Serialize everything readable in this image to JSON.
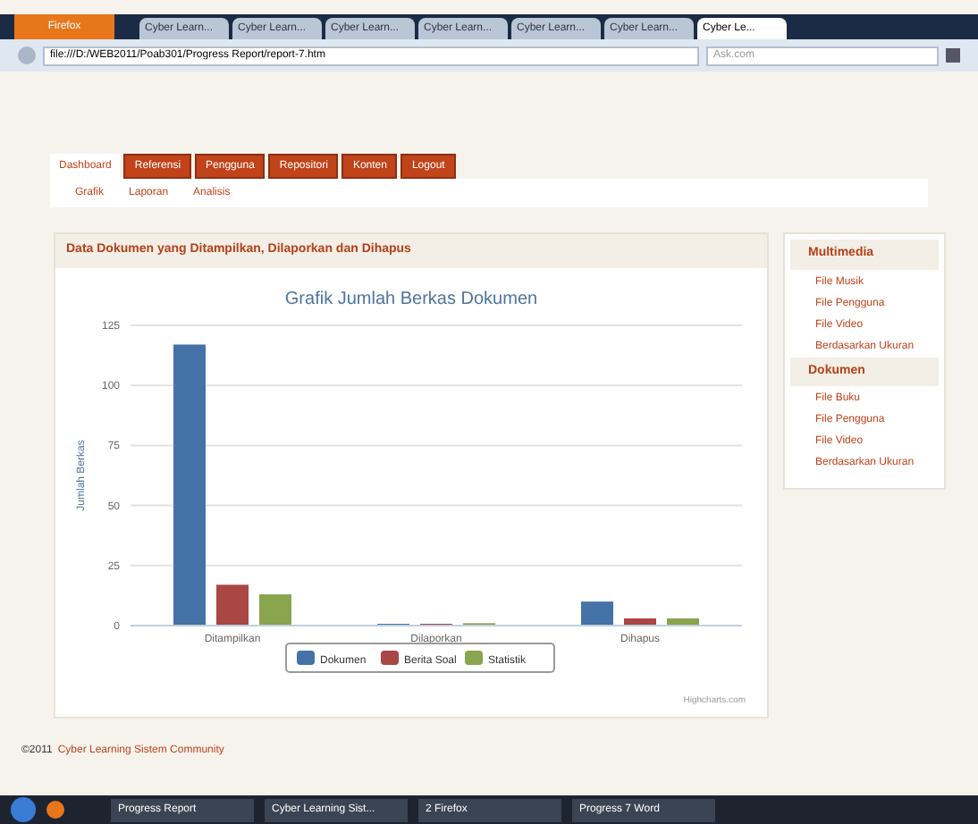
{
  "browser": {
    "button": "Firefox",
    "tabs": [
      {
        "label": "Cyber Learn...",
        "selected": false
      },
      {
        "label": "Cyber Learn...",
        "selected": false
      },
      {
        "label": "Cyber Learn...",
        "selected": false
      },
      {
        "label": "Cyber Learn...",
        "selected": false
      },
      {
        "label": "Cyber Learn...",
        "selected": false
      },
      {
        "label": "Cyber Learn...",
        "selected": false
      },
      {
        "label": "Cyber Le...",
        "selected": true
      }
    ],
    "url": "file:///D:/WEB2011/Poab301/Progress Report/report-7.htm",
    "search_placeholder": "Ask.com"
  },
  "nav": [
    {
      "label": "Dashboard",
      "selected": true
    },
    {
      "label": "Referensi",
      "selected": false
    },
    {
      "label": "Pengguna",
      "selected": false
    },
    {
      "label": "Repositori",
      "selected": false
    },
    {
      "label": "Konten",
      "selected": false
    },
    {
      "label": "Logout",
      "selected": false
    }
  ],
  "subnav": [
    "Grafik",
    "Laporan",
    "Analisis"
  ],
  "panel": {
    "title": "Data Dokumen yang Ditampilkan, Dilaporkan dan Dihapus",
    "credits": "Highcharts.com",
    "chart_data": {
      "type": "bar",
      "title": "Grafik Jumlah Berkas Dokumen",
      "ylabel": "Jumlah Berkas",
      "categories": [
        "Ditampilkan",
        "Dilaporkan",
        "Dihapus"
      ],
      "grid": true,
      "legend": "bottom",
      "ylim": [
        0,
        125
      ],
      "yticks": [
        0,
        25,
        50,
        75,
        100,
        125
      ],
      "series": [
        {
          "name": "Dokumen",
          "color": "#4572a7",
          "values": [
            117,
            0,
            10
          ]
        },
        {
          "name": "Berita Soal",
          "color": "#aa4643",
          "values": [
            17,
            0,
            3
          ]
        },
        {
          "name": "Statistik",
          "color": "#89a54e",
          "values": [
            13,
            1,
            3
          ]
        }
      ]
    }
  },
  "sidebar": [
    {
      "heading": "Multimedia",
      "items": [
        "File Musik",
        "File Pengguna",
        "File Video",
        "Berdasarkan Ukuran"
      ]
    },
    {
      "heading": "Dokumen",
      "items": [
        "File Buku",
        "File Pengguna",
        "File Video",
        "Berdasarkan Ukuran"
      ]
    }
  ],
  "footer": {
    "copyright": "©2011",
    "link": "Cyber Learning Sistem Community"
  },
  "taskbar": [
    "Progress Report",
    "Cyber Learning Sist...",
    "2 Firefox",
    "Progress 7 Word"
  ]
}
